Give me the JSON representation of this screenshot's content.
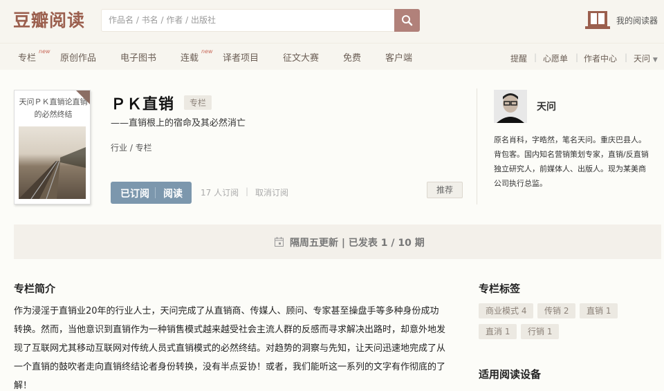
{
  "header": {
    "logo": "豆瓣阅读",
    "search_placeholder": "作品名 / 书名 / 作者 / 出版社",
    "reader_label": "我的阅读器"
  },
  "nav": {
    "items": [
      {
        "label": "专栏",
        "new": "new"
      },
      {
        "label": "原创作品"
      },
      {
        "label": "电子图书"
      },
      {
        "label": "连载",
        "new": "new"
      },
      {
        "label": "译者项目"
      },
      {
        "label": "征文大赛"
      },
      {
        "label": "免费"
      },
      {
        "label": "客户端"
      }
    ],
    "right": [
      "提醒",
      "心愿单",
      "作者中心",
      "天问"
    ]
  },
  "column": {
    "cover_text": "天问ＰＫ直销论直销的必然终结",
    "title": "ＰＫ直销",
    "type_badge": "专栏",
    "subtitle": "——直销根上的宿命及其必然消亡",
    "category": "行业 / 专栏",
    "subscribed_label": "已订阅",
    "read_label": "阅读",
    "subscribers": "17 人订阅",
    "unsubscribe": "取消订阅",
    "recommend": "推荐",
    "schedule": "隔周五更新 | 已发表 1 / 10 期"
  },
  "author": {
    "name": "天问",
    "bio": "原名肖科，字晧然，笔名天问。重庆巴县人。背包客。国内知名营销策划专家，直销/反直销独立研究人，前媒体人、出版人。现为某美商公司执行总监。"
  },
  "intro": {
    "heading": "专栏简介",
    "text": "作为浸淫于直销业20年的行业人士，天问完成了从直销商、传媒人、顾问、专家甚至操盘手等多种身份成功转换。然而，当他意识到直销作为一种销售模式越来越受社会主流人群的反感而寻求解决出路时，却意外地发现了互联网尤其移动互联网对传统人员式直销模式的必然终结。对趋势的洞察与先知，让天问迅速地完成了从一个直销的鼓吹者走向直销终结论者身份转换，没有半点妥协！或者，我们能听这一系列的文字有作彻底的了解！"
  },
  "tags": {
    "heading": "专栏标签",
    "items": [
      "商业模式 4",
      "传销 2",
      "直销 1",
      "直消 1",
      "行销 1"
    ]
  },
  "devices": {
    "heading": "适用阅读设备"
  },
  "colors": {
    "brand": "#9b5f4e",
    "button": "#7c97ad",
    "search_btn": "#b1817a"
  }
}
